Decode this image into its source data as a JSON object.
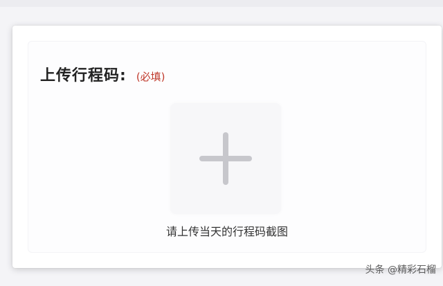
{
  "form": {
    "title": "上传行程码:",
    "required_label": "(必填)"
  },
  "upload": {
    "icon": "plus-icon",
    "hint": "请上传当天的行程码截图"
  },
  "watermark": "头条 @精彩石榴",
  "colors": {
    "required": "#c0392b",
    "plus": "#c7c7cc",
    "upload_bg": "#f7f7f9"
  }
}
